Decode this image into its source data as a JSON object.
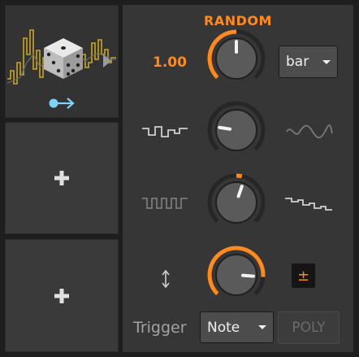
{
  "panel": {
    "title": "RANDOM",
    "amount_value": "1.00",
    "mode_select": {
      "value": "bar"
    },
    "trigger_label": "Trigger",
    "trigger_select": {
      "value": "Note"
    },
    "poly_label": "POLY",
    "bipolar_label": "±",
    "knobs": [
      {
        "name": "amount-knob",
        "level": 0.5,
        "accent": true
      },
      {
        "name": "smooth-knob",
        "level": 0.2,
        "accent": false
      },
      {
        "name": "quantize-knob",
        "level": 0.57,
        "accent": false
      },
      {
        "name": "slew-knob",
        "level": 0.85,
        "accent": true
      }
    ],
    "row_icons": [
      {
        "left": "stepped-wave-icon",
        "right": "smooth-wave-icon"
      },
      {
        "left": "square-wave-icon",
        "right": "descending-steps-icon"
      },
      {
        "left": "up-down-arrows-icon"
      }
    ]
  },
  "slots": [
    {
      "type": "random-device-preview",
      "icons": [
        "dice-icon",
        "modulation-arrow-icon"
      ]
    },
    {
      "type": "empty",
      "icon": "plus-icon"
    },
    {
      "type": "empty",
      "icon": "plus-icon"
    }
  ],
  "colors": {
    "accent": "#ff8a1f",
    "panel": "#363636",
    "slot": "#3a3a3a",
    "modulation": "#7fd3f7",
    "waveform": "#c7a82a"
  }
}
